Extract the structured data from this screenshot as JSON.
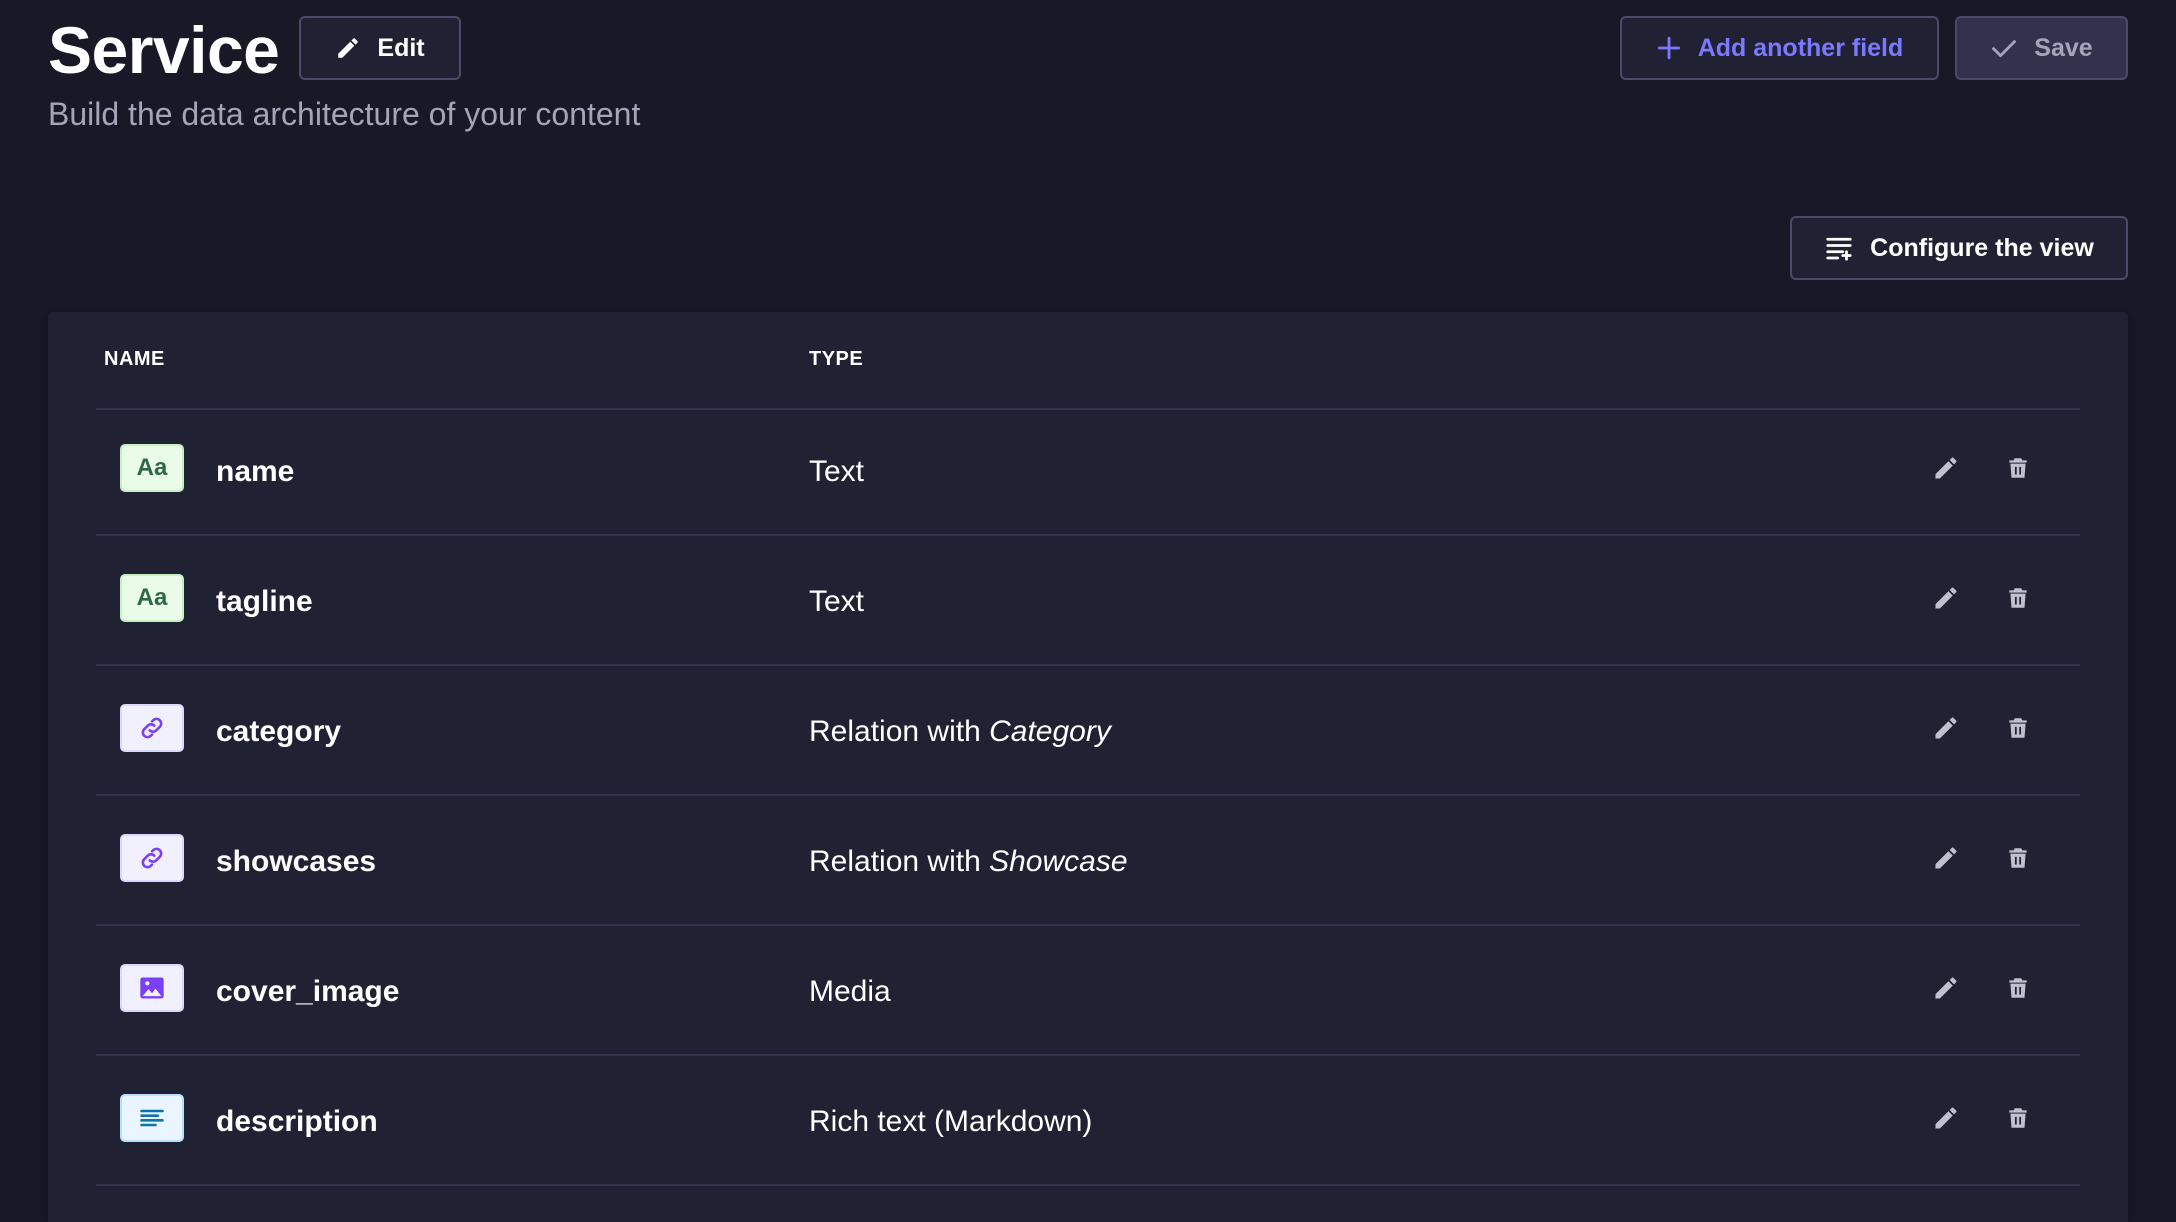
{
  "header": {
    "title": "Service",
    "subtitle": "Build the data architecture of your content",
    "edit_label": "Edit",
    "add_field_label": "Add another field",
    "save_label": "Save"
  },
  "toolbar": {
    "configure_label": "Configure the view"
  },
  "table": {
    "columns": {
      "name": "NAME",
      "type": "TYPE"
    },
    "rows": [
      {
        "name": "name",
        "type": "Text",
        "icon": "text-icon",
        "icon_text": "Aa"
      },
      {
        "name": "tagline",
        "type": "Text",
        "icon": "text-icon",
        "icon_text": "Aa"
      },
      {
        "name": "category",
        "type_prefix": "Relation with ",
        "type_target": "Category",
        "icon": "relation-icon"
      },
      {
        "name": "showcases",
        "type_prefix": "Relation with ",
        "type_target": "Showcase",
        "icon": "relation-icon"
      },
      {
        "name": "cover_image",
        "type": "Media",
        "icon": "media-icon"
      },
      {
        "name": "description",
        "type": "Rich text (Markdown)",
        "icon": "richtext-icon"
      }
    ]
  },
  "colors": {
    "background": "#181826",
    "card": "#212134",
    "border": "#4a4a6a",
    "accent": "#7b79ff",
    "muted": "#a5a5ba"
  }
}
